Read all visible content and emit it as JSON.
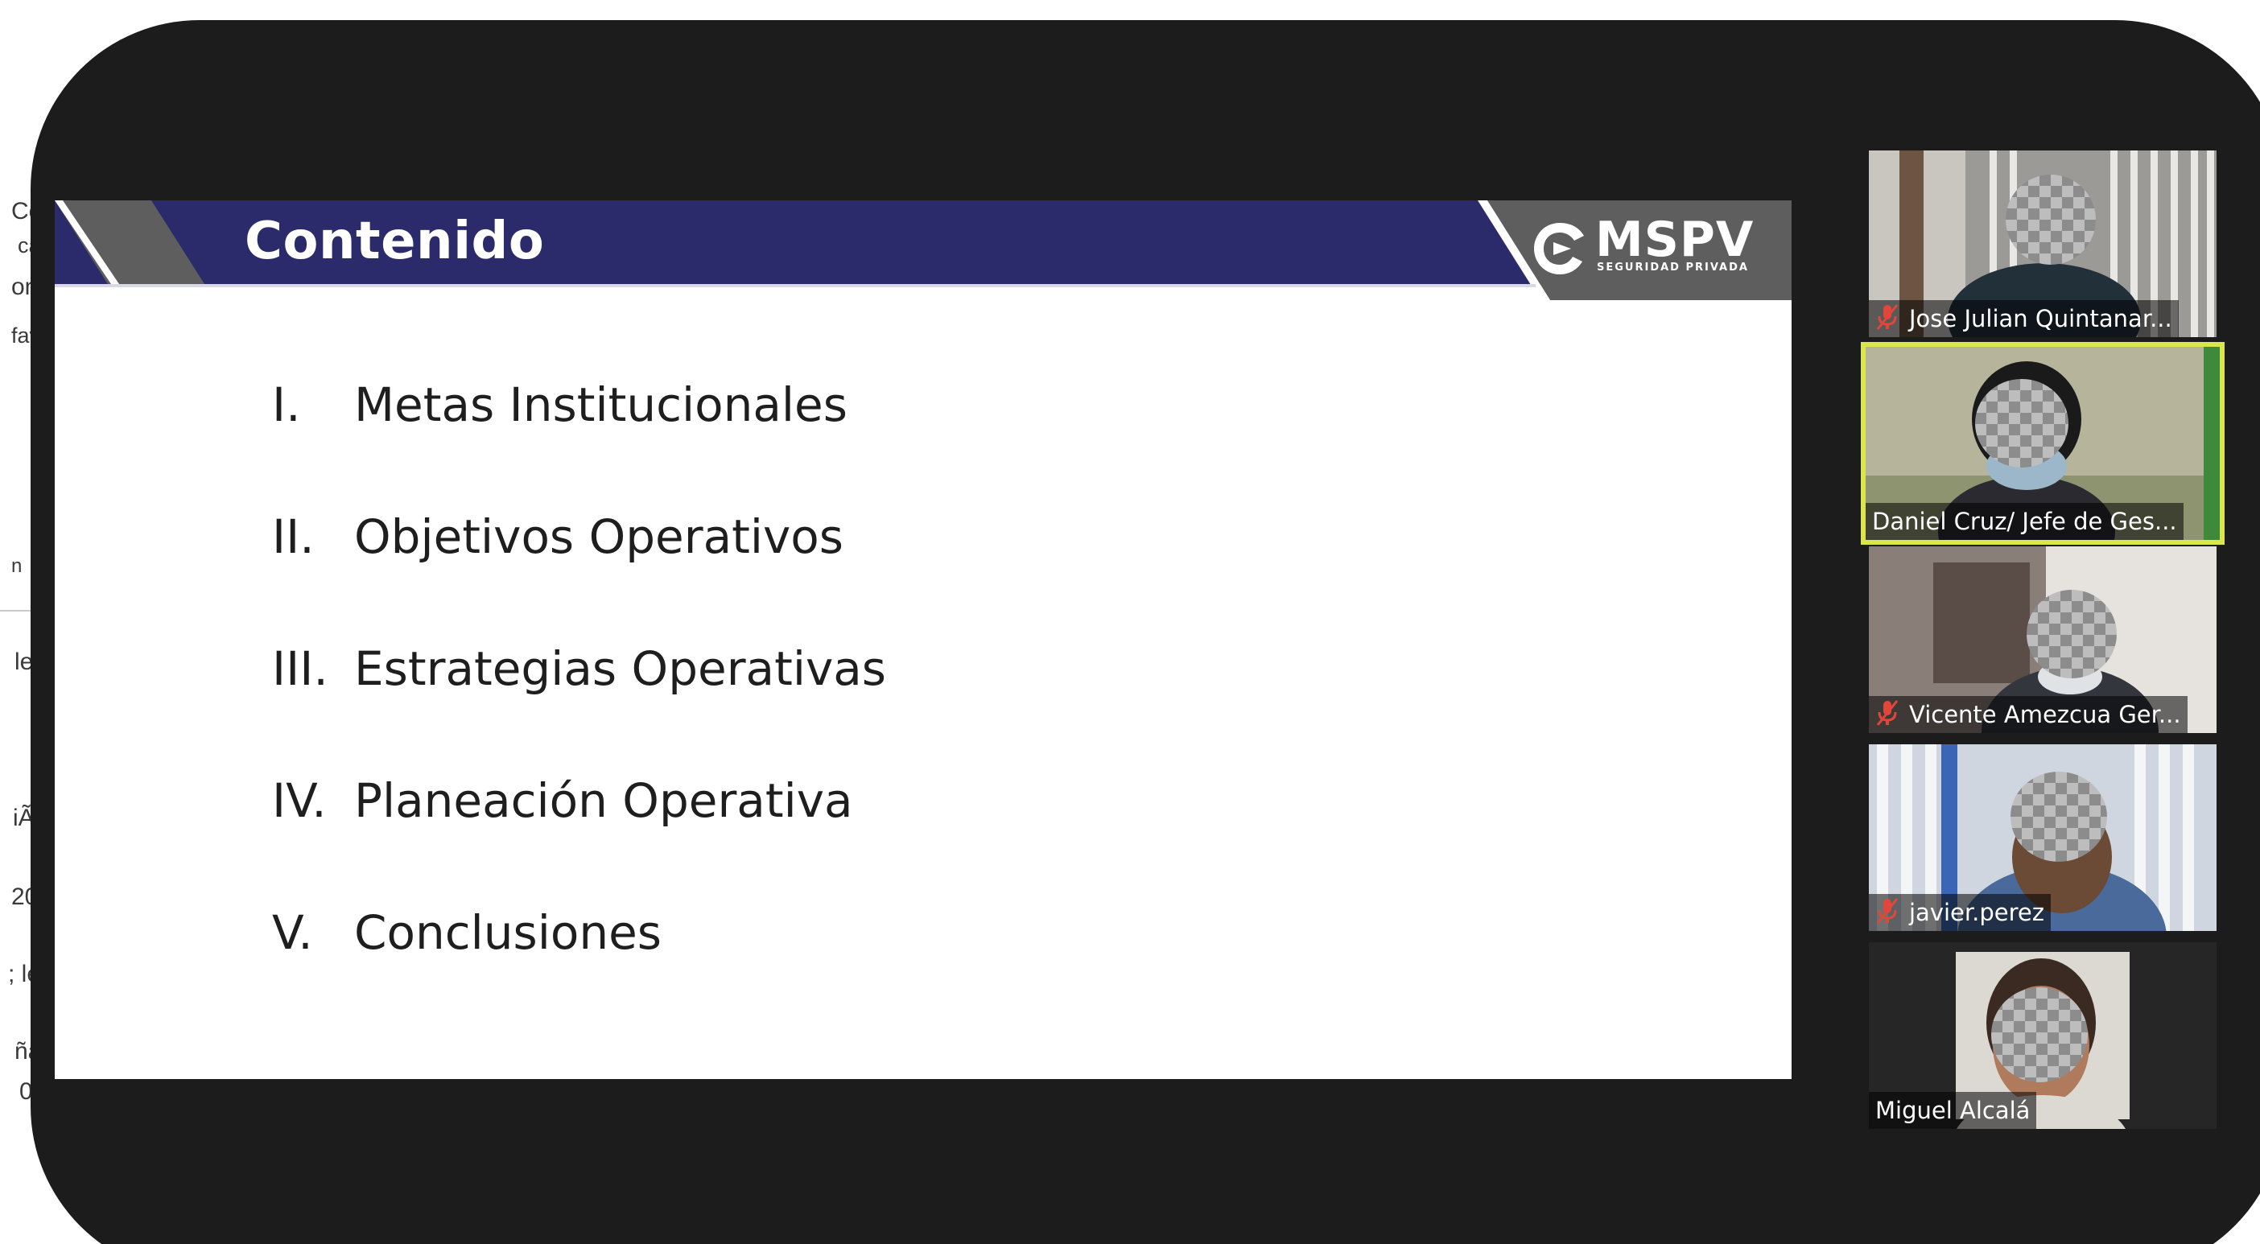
{
  "background_document": {
    "fragments": [
      "Co",
      "ca",
      "on",
      "fav",
      "n",
      "le",
      "iÃ",
      "20",
      "; le",
      "ña",
      "0"
    ]
  },
  "slide": {
    "title": "Contenido",
    "logo": {
      "name": "MSPV",
      "tagline": "SEGURIDAD PRIVADA",
      "icon": "mspv-logo-icon"
    },
    "toc": [
      {
        "num": "I.",
        "text": "Metas Institucionales"
      },
      {
        "num": "II.",
        "text": "Objetivos Operativos"
      },
      {
        "num": "III.",
        "text": "Estrategias Operativas"
      },
      {
        "num": "IV.",
        "text": "Planeación Operativa"
      },
      {
        "num": "V.",
        "text": "Conclusiones"
      }
    ],
    "colors": {
      "header_navy": "#2b2b6b",
      "header_gray": "#5e5e5e",
      "text": "#1e1e1e"
    }
  },
  "participants": [
    {
      "name": "Jose Julian Quintanar...",
      "muted": true,
      "speaking": false
    },
    {
      "name": "Daniel Cruz/ Jefe de Ges...",
      "muted": false,
      "speaking": true
    },
    {
      "name": "Vicente Amezcua Ger...",
      "muted": true,
      "speaking": false
    },
    {
      "name": "javier.perez",
      "muted": true,
      "speaking": false
    },
    {
      "name": "Miguel Alcalá",
      "muted": false,
      "speaking": false
    }
  ],
  "colors": {
    "frame": "#1c1c1c",
    "active_speaker_border": "#d9e64e",
    "muted_icon": "#e0473a"
  }
}
